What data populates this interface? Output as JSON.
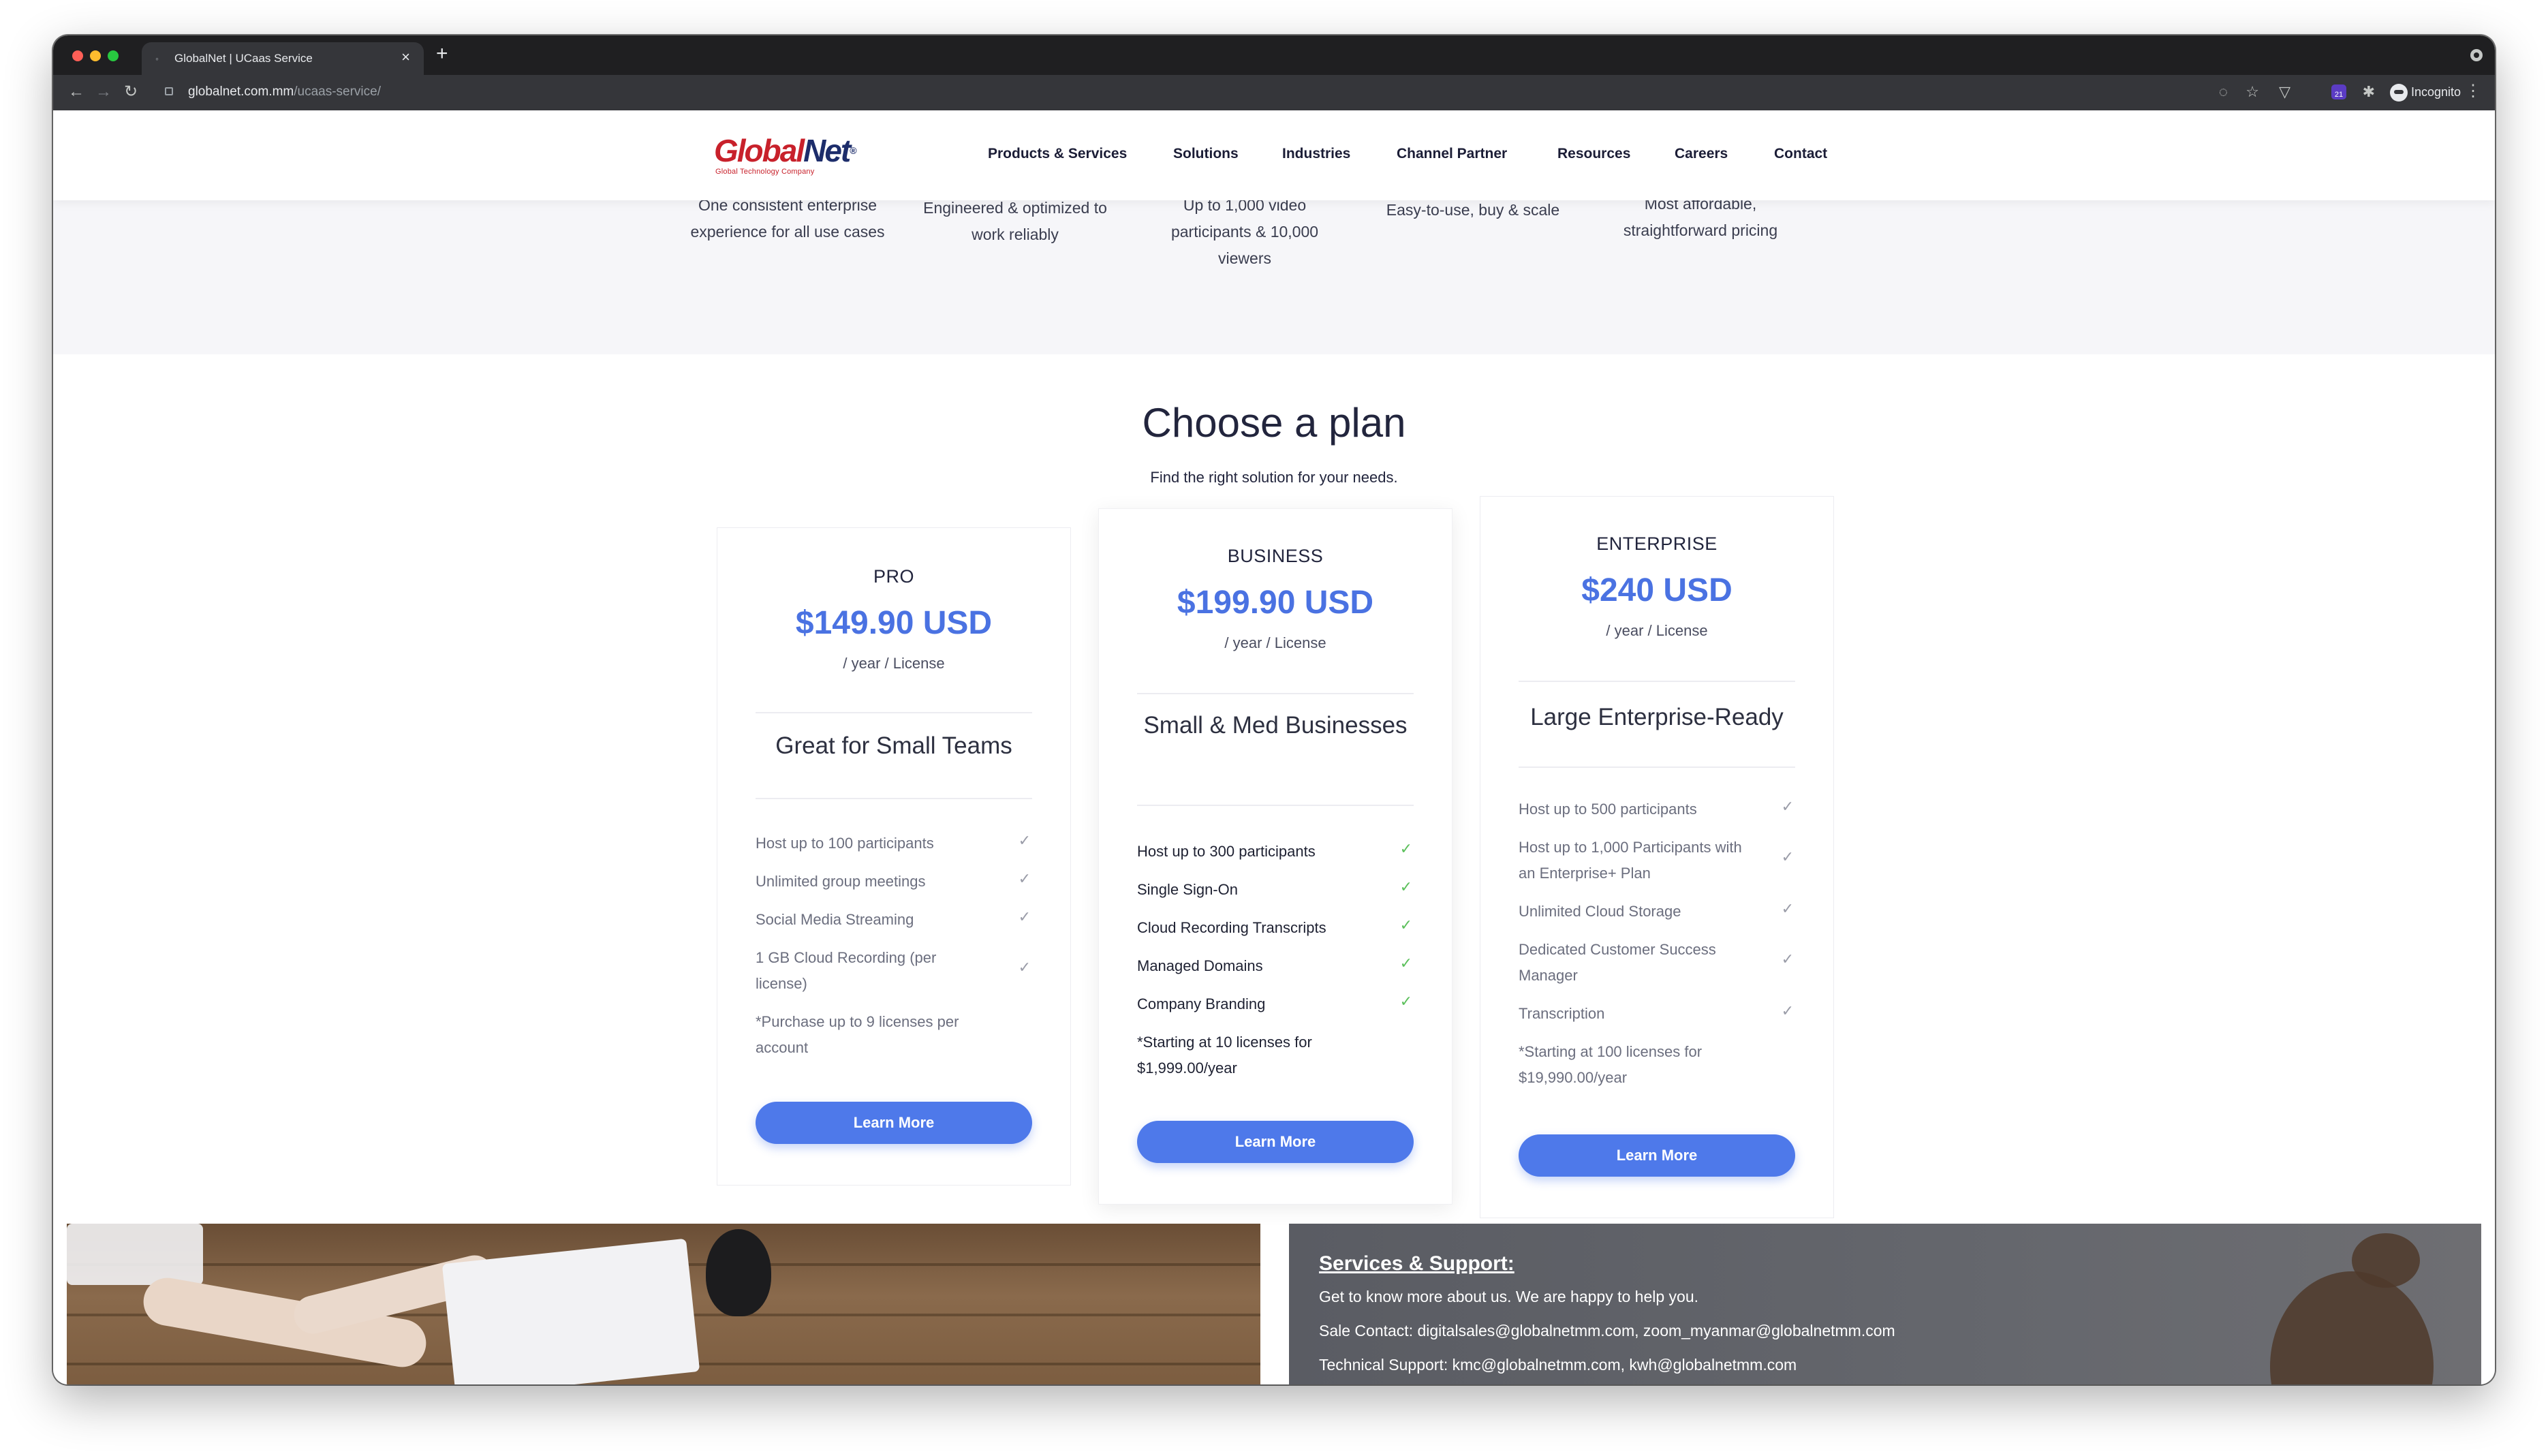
{
  "browser": {
    "tab_title": "GlobalNet | UCaas Service",
    "new_tab_icon": "plus-icon",
    "url_domain": "globalnet.com.mm",
    "url_path": "/ucaas-service/",
    "extension_badge": "21",
    "profile_label": "Incognito"
  },
  "site": {
    "logo_word_1": "Global",
    "logo_word_2": "Net",
    "logo_mark": "®",
    "logo_tagline": "Global Technology Company",
    "nav": [
      "Products & Services",
      "Solutions",
      "Industries",
      "Channel Partner",
      "Resources",
      "Careers",
      "Contact"
    ]
  },
  "features": [
    "One consistent enterprise experience for all use cases",
    "Engineered & optimized to work reliably",
    "Up to 1,000 video participants & 10,000 viewers",
    "Easy-to-use, buy & scale",
    "Most affordable, straightforward pricing"
  ],
  "plans": {
    "title": "Choose a plan",
    "subtitle": "Find the right solution for your needs.",
    "cards": [
      {
        "name": "PRO",
        "price": "$149.90 USD",
        "period": "/ year / License",
        "tagline": "Great for Small Teams",
        "features": [
          "Host up to 100 participants",
          "Unlimited group meetings",
          "Social Media Streaming",
          "1 GB Cloud Recording (per license)"
        ],
        "note": "*Purchase up to 9 licenses per account",
        "button": "Learn More"
      },
      {
        "name": "BUSINESS",
        "price": "$199.90 USD",
        "period": "/ year / License",
        "tagline": "Small & Med Businesses",
        "features": [
          "Host up to 300 participants",
          "Single Sign-On",
          "Cloud Recording Transcripts",
          "Managed Domains",
          "Company Branding"
        ],
        "note": "*Starting at 10 licenses for $1,999.00/year",
        "button": "Learn More"
      },
      {
        "name": "ENTERPRISE",
        "price": "$240 USD",
        "period": "/ year / License",
        "tagline": "Large Enterprise-Ready",
        "features": [
          "Host up to 500 participants",
          "Host up to 1,000 Participants with an Enterprise+ Plan",
          "Unlimited Cloud Storage",
          "Dedicated Customer Success Manager",
          "Transcription"
        ],
        "note": "*Starting at 100 licenses for $19,990.00/year",
        "button": "Learn More"
      }
    ],
    "check_glyph": "✓"
  },
  "support": {
    "title": "Services & Support:",
    "intro": "Get to know more about us. We are happy to help you.",
    "sales": "Sale Contact: digitalsales@globalnetmm.com, zoom_myanmar@globalnetmm.com",
    "technical": "Technical Support: kmc@globalnetmm.com, kwh@globalnetmm.com"
  },
  "colors": {
    "accent": "#4e79ea",
    "price": "#4a72e2",
    "check_featured": "#5cc05c",
    "logo_red": "#c8212b",
    "logo_navy": "#1d2d6b"
  }
}
